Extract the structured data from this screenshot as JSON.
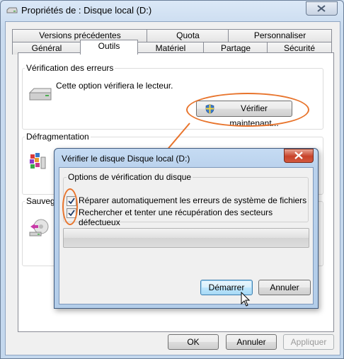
{
  "window": {
    "title": "Propriétés de : Disque local (D:)"
  },
  "tabs": {
    "row1": [
      "Versions précédentes",
      "Quota",
      "Personnaliser"
    ],
    "row2": [
      "Général",
      "Outils",
      "Matériel",
      "Partage",
      "Sécurité"
    ],
    "selected": "Outils"
  },
  "tools": {
    "error_check": {
      "group_label": "Vérification des erreurs",
      "description": "Cette option vérifiera le lecteur.",
      "button": "Vérifier maintenant..."
    },
    "defrag": {
      "group_label": "Défragmentation"
    },
    "backup": {
      "group_label": "Sauvega"
    }
  },
  "footer": {
    "ok": "OK",
    "cancel": "Annuler",
    "apply": "Appliquer"
  },
  "dialog": {
    "title": "Vérifier le disque Disque local (D:)",
    "group_label": "Options de vérification du disque",
    "option1": {
      "label": "Réparer automatiquement les erreurs de système de fichiers",
      "checked": true
    },
    "option2": {
      "label": "Rechercher et tenter une récupération des secteurs défectueux",
      "checked": true
    },
    "progress": 0,
    "start": "Démarrer",
    "cancel": "Annuler"
  },
  "colors": {
    "annotation": "#e8742c",
    "title_bar": "#c9dbef",
    "dialog_close": "#c7422a"
  }
}
